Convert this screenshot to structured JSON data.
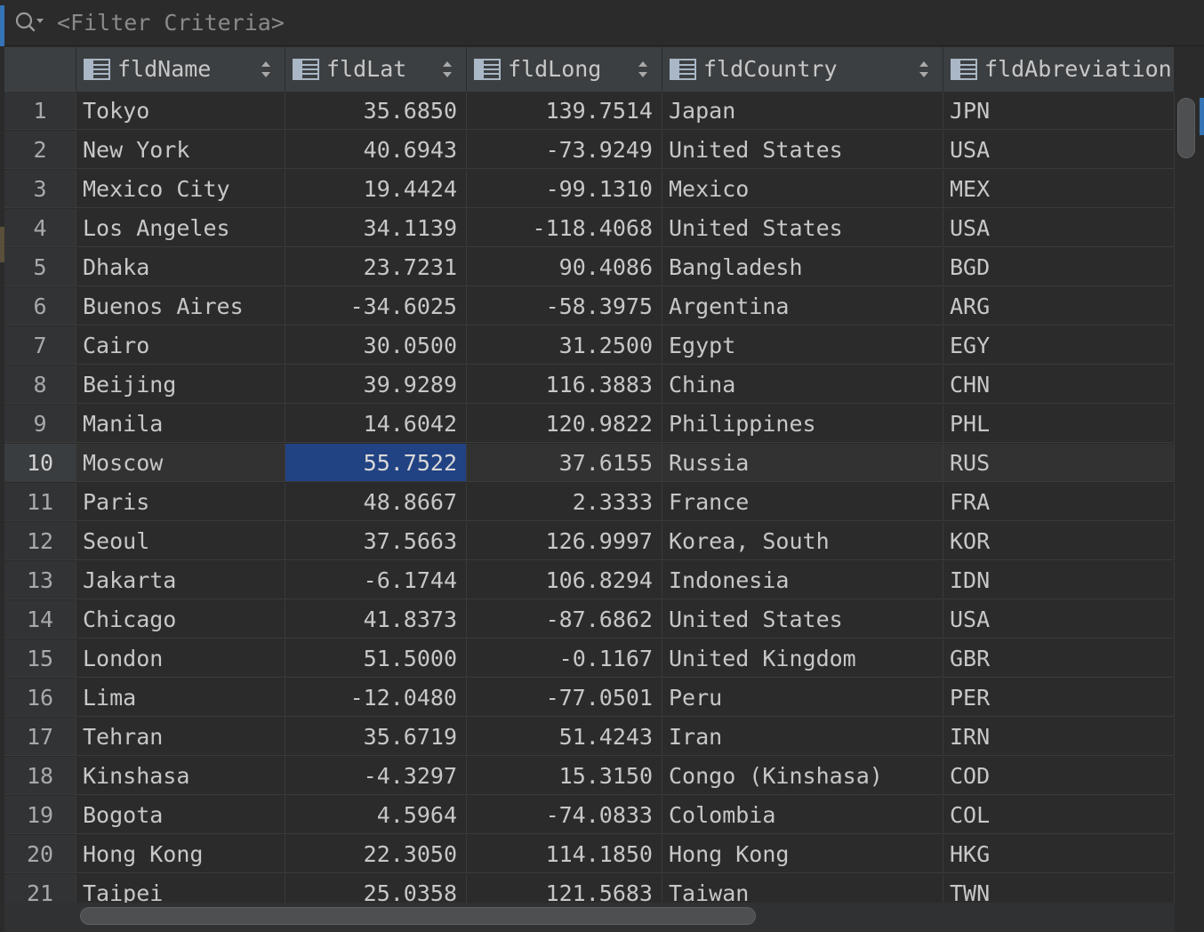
{
  "filter": {
    "placeholder": "<Filter Criteria>"
  },
  "columns": [
    {
      "key": "rownum",
      "label": ""
    },
    {
      "key": "fldName",
      "label": "fldName"
    },
    {
      "key": "fldLat",
      "label": "fldLat"
    },
    {
      "key": "fldLong",
      "label": "fldLong"
    },
    {
      "key": "fldCountry",
      "label": "fldCountry"
    },
    {
      "key": "fldAbreviation",
      "label": "fldAbreviation"
    }
  ],
  "rows": [
    {
      "n": "1",
      "name": "Tokyo",
      "lat": "35.6850",
      "long": "139.7514",
      "country": "Japan",
      "abbr": "JPN"
    },
    {
      "n": "2",
      "name": "New York",
      "lat": "40.6943",
      "long": "-73.9249",
      "country": "United States",
      "abbr": "USA"
    },
    {
      "n": "3",
      "name": "Mexico City",
      "lat": "19.4424",
      "long": "-99.1310",
      "country": "Mexico",
      "abbr": "MEX"
    },
    {
      "n": "4",
      "name": "Los Angeles",
      "lat": "34.1139",
      "long": "-118.4068",
      "country": "United States",
      "abbr": "USA"
    },
    {
      "n": "5",
      "name": "Dhaka",
      "lat": "23.7231",
      "long": "90.4086",
      "country": "Bangladesh",
      "abbr": "BGD"
    },
    {
      "n": "6",
      "name": "Buenos Aires",
      "lat": "-34.6025",
      "long": "-58.3975",
      "country": "Argentina",
      "abbr": "ARG"
    },
    {
      "n": "7",
      "name": "Cairo",
      "lat": "30.0500",
      "long": "31.2500",
      "country": "Egypt",
      "abbr": "EGY"
    },
    {
      "n": "8",
      "name": "Beijing",
      "lat": "39.9289",
      "long": "116.3883",
      "country": "China",
      "abbr": "CHN"
    },
    {
      "n": "9",
      "name": "Manila",
      "lat": "14.6042",
      "long": "120.9822",
      "country": "Philippines",
      "abbr": "PHL"
    },
    {
      "n": "10",
      "name": "Moscow",
      "lat": "55.7522",
      "long": "37.6155",
      "country": "Russia",
      "abbr": "RUS"
    },
    {
      "n": "11",
      "name": "Paris",
      "lat": "48.8667",
      "long": "2.3333",
      "country": "France",
      "abbr": "FRA"
    },
    {
      "n": "12",
      "name": "Seoul",
      "lat": "37.5663",
      "long": "126.9997",
      "country": "Korea, South",
      "abbr": "KOR"
    },
    {
      "n": "13",
      "name": "Jakarta",
      "lat": "-6.1744",
      "long": "106.8294",
      "country": "Indonesia",
      "abbr": "IDN"
    },
    {
      "n": "14",
      "name": "Chicago",
      "lat": "41.8373",
      "long": "-87.6862",
      "country": "United States",
      "abbr": "USA"
    },
    {
      "n": "15",
      "name": "London",
      "lat": "51.5000",
      "long": "-0.1167",
      "country": "United Kingdom",
      "abbr": "GBR"
    },
    {
      "n": "16",
      "name": "Lima",
      "lat": "-12.0480",
      "long": "-77.0501",
      "country": "Peru",
      "abbr": "PER"
    },
    {
      "n": "17",
      "name": "Tehran",
      "lat": "35.6719",
      "long": "51.4243",
      "country": "Iran",
      "abbr": "IRN"
    },
    {
      "n": "18",
      "name": "Kinshasa",
      "lat": "-4.3297",
      "long": "15.3150",
      "country": "Congo (Kinshasa)",
      "abbr": "COD"
    },
    {
      "n": "19",
      "name": "Bogota",
      "lat": "4.5964",
      "long": "-74.0833",
      "country": "Colombia",
      "abbr": "COL"
    },
    {
      "n": "20",
      "name": "Hong Kong",
      "lat": "22.3050",
      "long": "114.1850",
      "country": "Hong Kong",
      "abbr": "HKG"
    },
    {
      "n": "21",
      "name": "Taipei",
      "lat": "25.0358",
      "long": "121.5683",
      "country": "Taiwan",
      "abbr": "TWN"
    }
  ],
  "selection": {
    "row": "10",
    "column": "fldLat"
  },
  "colors": {
    "selection": "#214283",
    "accent": "#3574b6",
    "background": "#2b2b2b",
    "header": "#3c3f41"
  }
}
